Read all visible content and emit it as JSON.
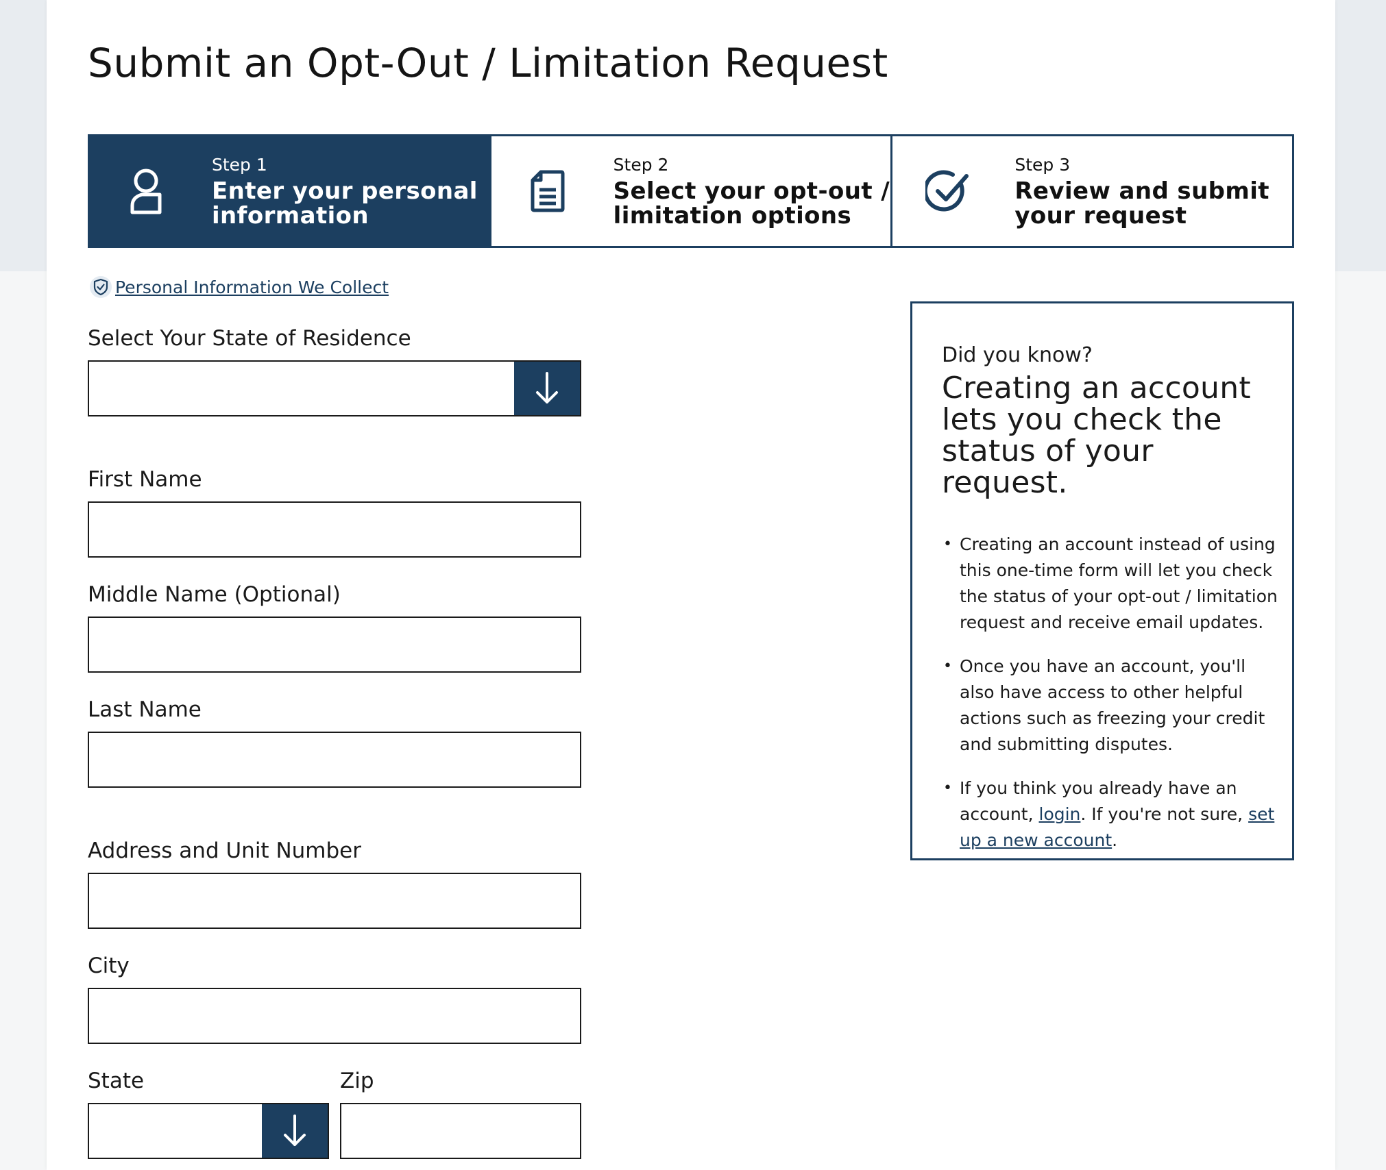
{
  "page": {
    "title": "Submit an Opt-Out / Limitation Request"
  },
  "stepper": {
    "steps": [
      {
        "num": "Step 1",
        "label_line1": "Enter your personal",
        "label_line2": "information",
        "icon": "person-icon",
        "active": true
      },
      {
        "num": "Step 2",
        "label_line1": "Select your opt-out /",
        "label_line2": "limitation options",
        "icon": "document-icon",
        "active": false
      },
      {
        "num": "Step 3",
        "label_line1": "Review and submit",
        "label_line2": "your request",
        "icon": "checkmark-circle-icon",
        "active": false
      }
    ]
  },
  "pi_link": {
    "label": "Personal Information We Collect",
    "icon": "shield-check-icon"
  },
  "form": {
    "state_of_residence": {
      "label": "Select Your State of Residence",
      "value": ""
    },
    "first_name": {
      "label": "First Name",
      "value": ""
    },
    "middle_name": {
      "label": "Middle Name (Optional)",
      "value": ""
    },
    "last_name": {
      "label": "Last Name",
      "value": ""
    },
    "address": {
      "label": "Address and Unit Number",
      "value": ""
    },
    "city": {
      "label": "City",
      "value": ""
    },
    "state": {
      "label": "State",
      "value": ""
    },
    "zip": {
      "label": "Zip",
      "value": ""
    }
  },
  "info_panel": {
    "kicker": "Did you know?",
    "headline_line1": "Creating an account",
    "headline_line2": "lets you check the",
    "headline_line3": "status of your request.",
    "bullet1": "Creating an account instead of using this one-time form will let you check the status of your opt-out / limitation request and receive email updates.",
    "bullet2": "Once you have an account, you'll also have access to other helpful actions such as freezing your credit and submitting disputes.",
    "bullet3_pre": "If you think you already have an account, ",
    "bullet3_login": "login",
    "bullet3_mid": ". If you're not sure, ",
    "bullet3_setup": "set up a new account",
    "bullet3_post": "."
  },
  "colors": {
    "brand": "#1c3f60",
    "band": "#e8ecf0"
  }
}
